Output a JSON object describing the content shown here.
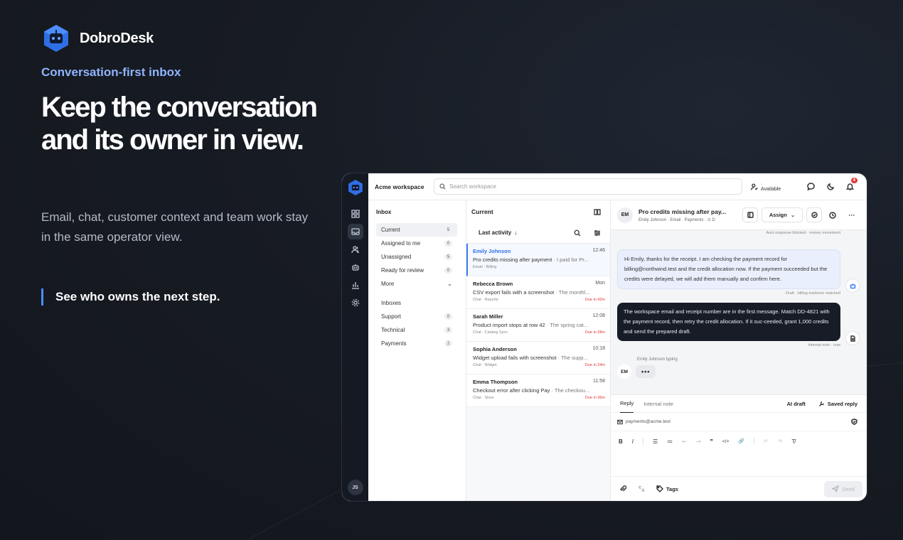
{
  "brand": {
    "name": "DobroDesk"
  },
  "hero": {
    "eyebrow": "Conversation-first inbox",
    "headline": "Keep the conversation and its owner in view.",
    "subtext": "Email, chat, customer context and team work stay in the same operator view.",
    "callout": "See who owns the next step."
  },
  "app": {
    "workspace": "Acme workspace",
    "search_placeholder": "Search workspace",
    "status": "· Available",
    "notification_count": "4",
    "user_initials": "JS",
    "rail_icons": [
      "grid-icon",
      "inbox-icon",
      "users-icon",
      "bot-icon",
      "chart-icon",
      "settings-icon"
    ],
    "nav": {
      "title": "Inbox",
      "items": [
        {
          "label": "Current",
          "count": "5"
        },
        {
          "label": "Assigned to me",
          "count": "0"
        },
        {
          "label": "Unassigned",
          "count": "5"
        },
        {
          "label": "Ready for review",
          "count": "0"
        }
      ],
      "more": "More",
      "section": "Inboxes",
      "inboxes": [
        {
          "label": "Support",
          "count": "0"
        },
        {
          "label": "Technical",
          "count": "3"
        },
        {
          "label": "Payments",
          "count": "2"
        }
      ]
    },
    "list": {
      "title": "Current",
      "sort": "Last activity",
      "items": [
        {
          "name": "Emily Johnson",
          "time": "12:46",
          "subject": "Pro credits missing after payment",
          "preview": " · I paid for Pr...",
          "meta": "Email · Billing",
          "due": ""
        },
        {
          "name": "Rebecca Brown",
          "time": "Mon",
          "subject": "CSV export fails with a screenshot",
          "preview": " · The monthl...",
          "meta": "Chat · Reports",
          "due": "Due in 42m"
        },
        {
          "name": "Sarah Miller",
          "time": "12:08",
          "subject": "Product import stops at row 42",
          "preview": " · The spring cat...",
          "meta": "Chat · Catalog Sync",
          "due": "Due in 28m"
        },
        {
          "name": "Sophia Anderson",
          "time": "10:18",
          "subject": "Widget upload fails with screenshot",
          "preview": " · The supp...",
          "meta": "Chat · Widget",
          "due": "Due in 24m"
        },
        {
          "name": "Emma Thompson",
          "time": "11:58",
          "subject": "Checkout error after clicking Pay",
          "preview": " · The checkou...",
          "meta": "Chat · Store",
          "due": "Due in 36m"
        }
      ]
    },
    "thread": {
      "avatar": "EM",
      "title": "Pro credits missing after pay...",
      "subtitle": "Emily Johnson · Email · Payments · ⊙ D",
      "assign": "Assign",
      "top_meta": "Auto response blocked · money movement",
      "ai_draft": "Hi Emily, thanks for the receipt. I am checking the payment record for billing@northwind.test and the credit allocation now. If the payment succeeded but the credits were delayed, we will add them manually and confirm here.",
      "ai_meta": "Draft · billing evidence matched",
      "note": "The workspace email and receipt number are in the first message. Match DD-4821 with the payment record, then retry the credit allocation. If it suc-ceeded, grant 1,000 credits and send the prepared draft.",
      "note_meta": "Internal note · now",
      "typing_label": "Emily Johnson  typing",
      "typing_avatar": "EM",
      "typing_dots": "•••"
    },
    "composer": {
      "tabs": [
        "Reply",
        "Internal note"
      ],
      "ai_draft": "AI draft",
      "saved_reply": "Saved reply",
      "to": "payments@acme.test",
      "format": [
        "B",
        "I",
        "☰",
        "≔",
        "⇤",
        "⇥",
        "❞",
        "</>",
        "🔗",
        "↶",
        "↷",
        "T̸"
      ],
      "tags": "Tags",
      "send": "Send"
    }
  }
}
